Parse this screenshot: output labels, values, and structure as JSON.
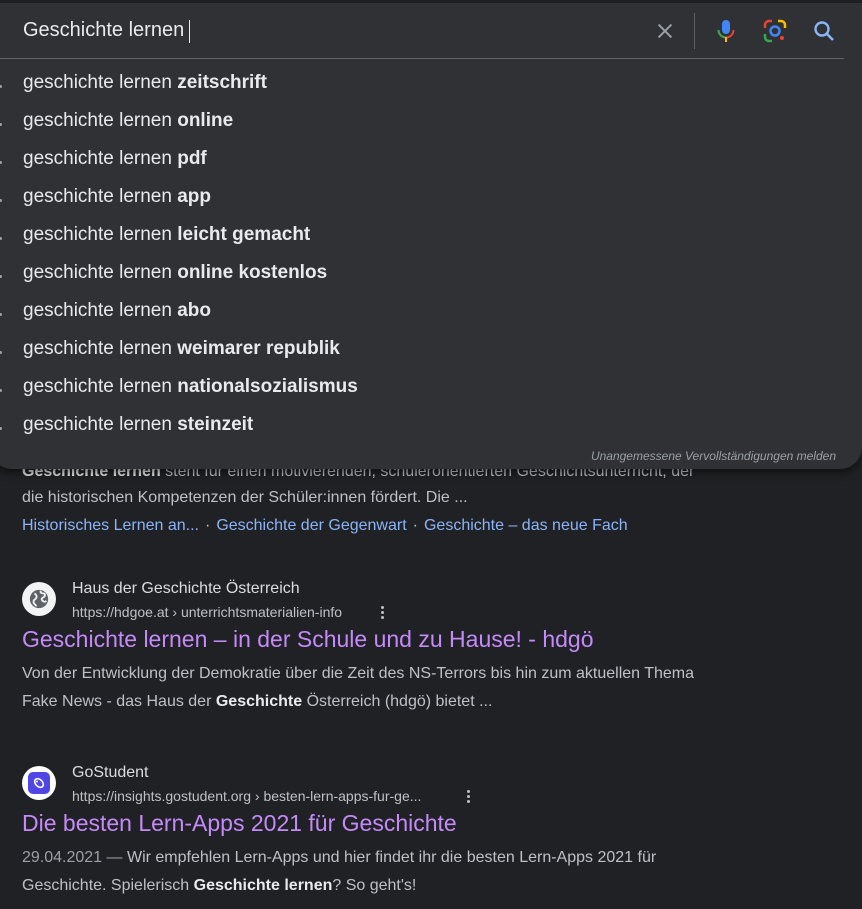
{
  "search": {
    "query": "Geschichte lernen",
    "suggestions": [
      {
        "prefix": "geschichte lernen ",
        "completion": "zeitschrift"
      },
      {
        "prefix": "geschichte lernen ",
        "completion": "online"
      },
      {
        "prefix": "geschichte lernen ",
        "completion": "pdf"
      },
      {
        "prefix": "geschichte lernen ",
        "completion": "app"
      },
      {
        "prefix": "geschichte lernen ",
        "completion": "leicht gemacht"
      },
      {
        "prefix": "geschichte lernen ",
        "completion": "online kostenlos"
      },
      {
        "prefix": "geschichte lernen ",
        "completion": "abo"
      },
      {
        "prefix": "geschichte lernen ",
        "completion": "weimarer republik"
      },
      {
        "prefix": "geschichte lernen ",
        "completion": "nationalsozialismus"
      },
      {
        "prefix": "geschichte lernen ",
        "completion": "steinzeit"
      }
    ],
    "report_label": "Unangemessene Vervollständigungen melden",
    "icons": {
      "clear": "close-icon",
      "voice": "microphone-icon",
      "lens": "camera-lens-icon",
      "search": "search-icon"
    }
  },
  "results": {
    "first": {
      "snippet_hidden_bold": "Geschichte lernen",
      "snippet_hidden_rest": " steht für einen motivierenden, schülerorientierten Geschichtsunterricht, der",
      "snippet_line2": "die historischen Kompetenzen der Schüler:innen fördert. Die ...",
      "sitelinks": [
        "Historisches Lernen an...",
        "Geschichte der Gegenwart",
        "Geschichte – das neue Fach"
      ],
      "sitelink_sep": "·"
    },
    "hdgoe": {
      "site_name": "Haus der Geschichte Österreich",
      "url": "https://hdgoe.at › unterrichtsmaterialien-info",
      "title": "Geschichte lernen – in der Schule und zu Hause! - hdgö",
      "snippet_line1": "Von der Entwicklung der Demokratie über die Zeit des NS-Terrors bis hin zum aktuellen Thema",
      "snippet_line2_a": "Fake News - das Haus der ",
      "snippet_line2_bold": "Geschichte",
      "snippet_line2_b": " Österreich (hdgö) bietet ...",
      "favicon": "globe-icon"
    },
    "gostudent": {
      "site_name": "GoStudent",
      "url": "https://insights.gostudent.org › besten-lern-apps-fur-ge...",
      "title": "Die besten Lern-Apps 2021 für Geschichte",
      "date": "29.04.2021",
      "date_sep": " — ",
      "snippet_line1": "Wir empfehlen Lern-Apps und hier findet ihr die besten Lern-Apps 2021 für",
      "snippet_line2_a": "Geschichte. Spielerisch ",
      "snippet_line2_bold": "Geschichte lernen",
      "snippet_line2_b": "? So geht's!",
      "favicon": "gostudent-logo-icon"
    }
  },
  "colors": {
    "background": "#202124",
    "dropdown": "#303134",
    "link_blue": "#8ab4f8",
    "visited_purple": "#c58af9",
    "text": "#bdc1c6"
  }
}
